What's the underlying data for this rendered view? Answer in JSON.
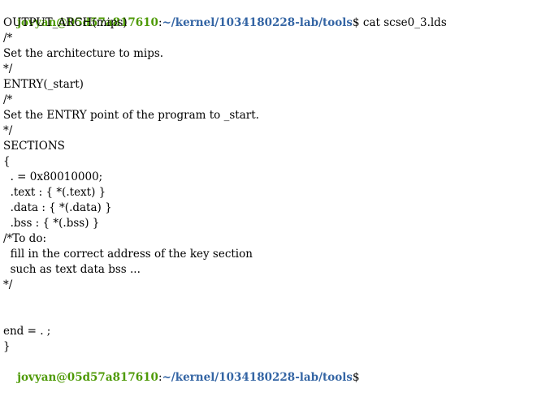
{
  "terminal": {
    "prompt_user": "jovyan@05d57a817610",
    "prompt_sep": ":",
    "prompt_path": "~/kernel/1034180228-lab/tools",
    "prompt_dollar": "$",
    "command": " cat scse0_3.lds",
    "output_lines": [
      "OUTPUT_ARCH(mips)",
      "/*",
      "Set the architecture to mips.",
      "*/",
      "ENTRY(_start)",
      "/*",
      "Set the ENTRY point of the program to _start.",
      "*/",
      "SECTIONS",
      "{",
      "  . = 0x80010000;",
      "  .text : { *(.text) }",
      "  .data : { *(.data) }",
      "  .bss : { *(.bss) }",
      "/*To do:",
      "  fill in the correct address of the key section",
      "  such as text data bss ...",
      "*/",
      "",
      "",
      "end = . ;",
      "}"
    ],
    "colors": {
      "user": "#4e9a06",
      "path": "#3465a4",
      "text": "#000000",
      "background": "#ffffff"
    }
  }
}
